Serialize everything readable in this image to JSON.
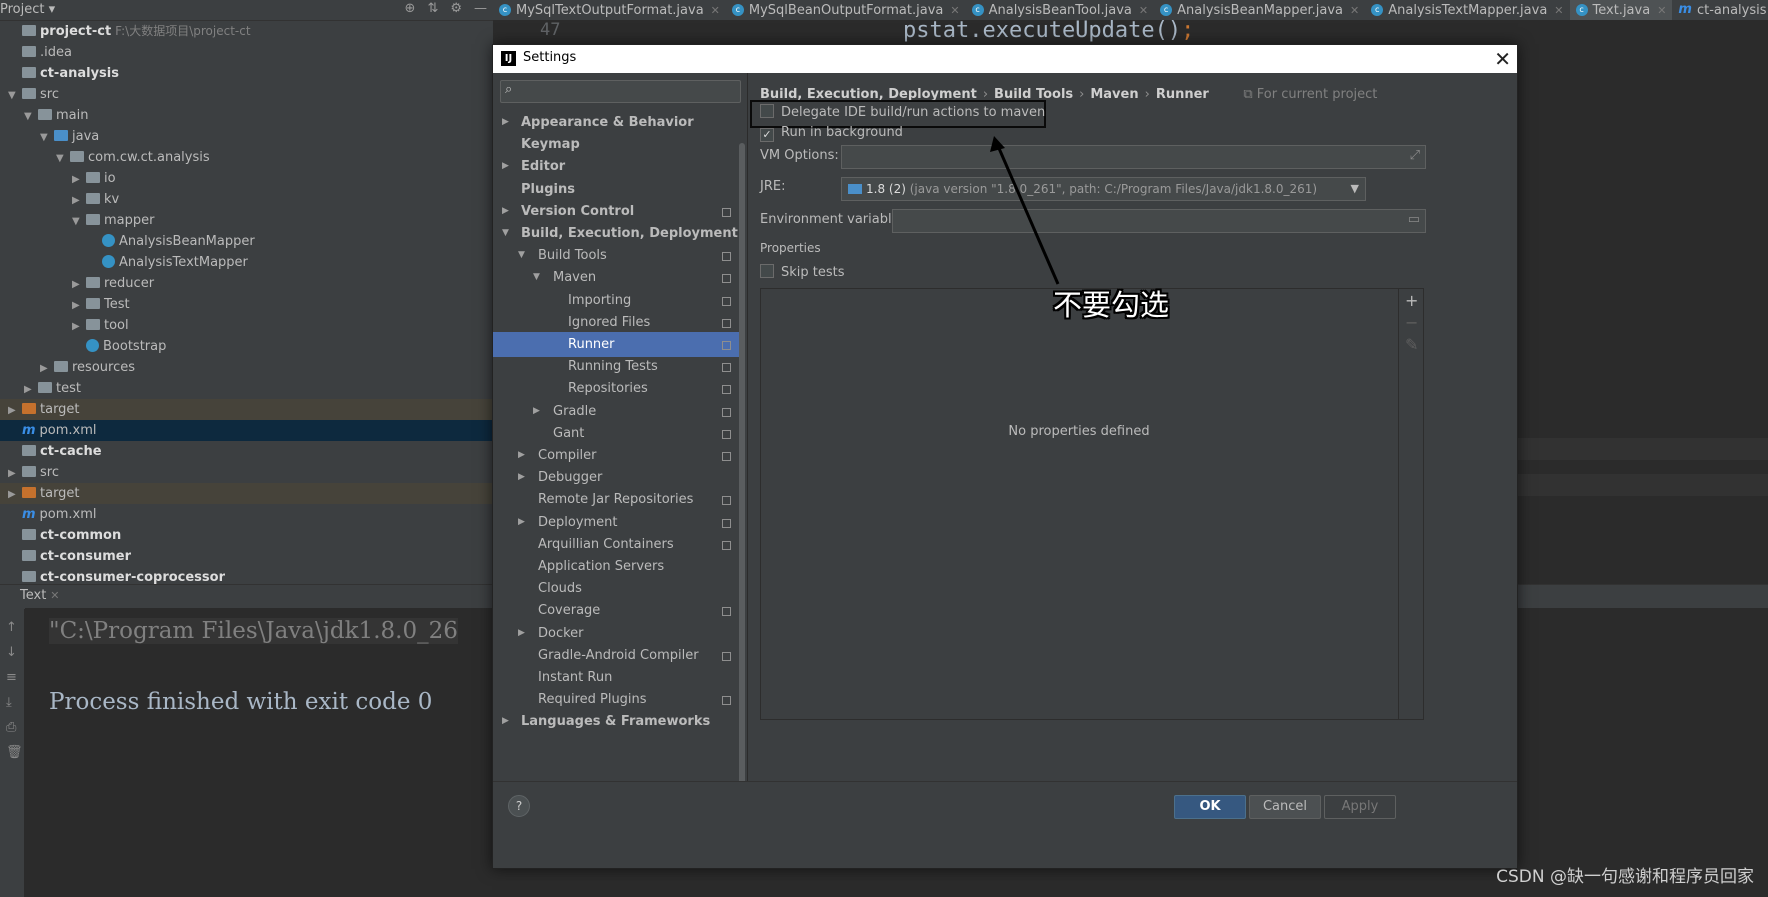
{
  "project_header": {
    "title": "Project ▾"
  },
  "editor_tabs": [
    {
      "label": "MySqlTextOutputFormat.java",
      "icon": "class-icon"
    },
    {
      "label": "MySqlBeanOutputFormat.java",
      "icon": "class-icon"
    },
    {
      "label": "AnalysisBeanTool.java",
      "icon": "class-icon"
    },
    {
      "label": "AnalysisBeanMapper.java",
      "icon": "class-icon"
    },
    {
      "label": "AnalysisTextMapper.java",
      "icon": "class-icon"
    },
    {
      "label": "Text.java",
      "icon": "class-icon",
      "active": true
    },
    {
      "label": "ct-analysis",
      "icon": "maven-icon"
    }
  ],
  "code": {
    "line_no": "47",
    "line": "pstat.executeUpdate()",
    "semi": ";"
  },
  "project_tree": [
    {
      "label": "project-ct",
      "extra": "F:\\大数据项目\\project-ct",
      "bold": true,
      "indent": 0,
      "arrow": "",
      "icon": "folder"
    },
    {
      "label": ".idea",
      "indent": 0,
      "arrow": "",
      "icon": "folder"
    },
    {
      "label": "ct-analysis",
      "bold": true,
      "indent": 0,
      "arrow": "",
      "icon": "folder"
    },
    {
      "label": "src",
      "indent": 0,
      "arrow": "▼",
      "icon": "folder"
    },
    {
      "label": "main",
      "indent": 1,
      "arrow": "▼",
      "icon": "folder"
    },
    {
      "label": "java",
      "indent": 2,
      "arrow": "▼",
      "icon": "folder-blue"
    },
    {
      "label": "com.cw.ct.analysis",
      "indent": 3,
      "arrow": "▼",
      "icon": "folder"
    },
    {
      "label": "io",
      "indent": 4,
      "arrow": "▶",
      "icon": "folder"
    },
    {
      "label": "kv",
      "indent": 4,
      "arrow": "▶",
      "icon": "folder"
    },
    {
      "label": "mapper",
      "indent": 4,
      "arrow": "▼",
      "icon": "folder"
    },
    {
      "label": "AnalysisBeanMapper",
      "indent": 5,
      "arrow": "",
      "icon": "class"
    },
    {
      "label": "AnalysisTextMapper",
      "indent": 5,
      "arrow": "",
      "icon": "class"
    },
    {
      "label": "reducer",
      "indent": 4,
      "arrow": "▶",
      "icon": "folder"
    },
    {
      "label": "Test",
      "indent": 4,
      "arrow": "▶",
      "icon": "folder"
    },
    {
      "label": "tool",
      "indent": 4,
      "arrow": "▶",
      "icon": "folder"
    },
    {
      "label": "Bootstrap",
      "indent": 4,
      "arrow": "",
      "icon": "class"
    },
    {
      "label": "resources",
      "indent": 2,
      "arrow": "▶",
      "icon": "folder"
    },
    {
      "label": "test",
      "indent": 1,
      "arrow": "▶",
      "icon": "folder"
    },
    {
      "label": "target",
      "indent": 0,
      "arrow": "▶",
      "icon": "folder-orange",
      "hl": "target"
    },
    {
      "label": "pom.xml",
      "indent": 0,
      "arrow": "",
      "icon": "maven",
      "hl": "pom"
    },
    {
      "label": "ct-cache",
      "bold": true,
      "indent": 0,
      "arrow": "",
      "icon": "folder"
    },
    {
      "label": "src",
      "indent": 0,
      "arrow": "▶",
      "icon": "folder"
    },
    {
      "label": "target",
      "indent": 0,
      "arrow": "▶",
      "icon": "folder-orange",
      "hl": "target"
    },
    {
      "label": "pom.xml",
      "indent": 0,
      "arrow": "",
      "icon": "maven"
    },
    {
      "label": "ct-common",
      "bold": true,
      "indent": 0,
      "arrow": "",
      "icon": "folder"
    },
    {
      "label": "ct-consumer",
      "bold": true,
      "indent": 0,
      "arrow": "",
      "icon": "folder"
    },
    {
      "label": "ct-consumer-coprocessor",
      "bold": true,
      "indent": 0,
      "arrow": "",
      "icon": "folder"
    }
  ],
  "run_panel": {
    "tab": "Text",
    "line1": "\"C:\\Program Files\\Java\\jdk1.8.0_26",
    "line2": "Process finished with exit code 0"
  },
  "dialog": {
    "title": "Settings",
    "search_placeholder": "",
    "nav": [
      {
        "label": "Appearance & Behavior",
        "bold": true,
        "arrow": "▶",
        "level": 0
      },
      {
        "label": "Keymap",
        "bold": true,
        "arrow": "",
        "level": 0
      },
      {
        "label": "Editor",
        "bold": true,
        "arrow": "▶",
        "level": 0
      },
      {
        "label": "Plugins",
        "bold": true,
        "arrow": "",
        "level": 0
      },
      {
        "label": "Version Control",
        "bold": true,
        "arrow": "▶",
        "level": 0,
        "proj": true
      },
      {
        "label": "Build, Execution, Deployment",
        "bold": true,
        "arrow": "▼",
        "level": 0
      },
      {
        "label": "Build Tools",
        "arrow": "▼",
        "level": 1,
        "proj": true
      },
      {
        "label": "Maven",
        "arrow": "▼",
        "level": 2,
        "proj": true
      },
      {
        "label": "Importing",
        "arrow": "",
        "level": 3,
        "proj": true
      },
      {
        "label": "Ignored Files",
        "arrow": "",
        "level": 3,
        "proj": true
      },
      {
        "label": "Runner",
        "arrow": "",
        "level": 3,
        "proj": true,
        "selected": true
      },
      {
        "label": "Running Tests",
        "arrow": "",
        "level": 3,
        "proj": true
      },
      {
        "label": "Repositories",
        "arrow": "",
        "level": 3,
        "proj": true
      },
      {
        "label": "Gradle",
        "arrow": "▶",
        "level": 2,
        "proj": true
      },
      {
        "label": "Gant",
        "arrow": "",
        "level": 2,
        "proj": true
      },
      {
        "label": "Compiler",
        "arrow": "▶",
        "level": 1,
        "proj": true
      },
      {
        "label": "Debugger",
        "arrow": "▶",
        "level": 1
      },
      {
        "label": "Remote Jar Repositories",
        "arrow": "",
        "level": 1,
        "proj": true
      },
      {
        "label": "Deployment",
        "arrow": "▶",
        "level": 1,
        "proj": true
      },
      {
        "label": "Arquillian Containers",
        "arrow": "",
        "level": 1,
        "proj": true
      },
      {
        "label": "Application Servers",
        "arrow": "",
        "level": 1
      },
      {
        "label": "Clouds",
        "arrow": "",
        "level": 1
      },
      {
        "label": "Coverage",
        "arrow": "",
        "level": 1,
        "proj": true
      },
      {
        "label": "Docker",
        "arrow": "▶",
        "level": 1
      },
      {
        "label": "Gradle-Android Compiler",
        "arrow": "",
        "level": 1,
        "proj": true
      },
      {
        "label": "Instant Run",
        "arrow": "",
        "level": 1
      },
      {
        "label": "Required Plugins",
        "arrow": "",
        "level": 1,
        "proj": true
      },
      {
        "label": "Languages & Frameworks",
        "bold": true,
        "arrow": "▶",
        "level": 0
      }
    ],
    "breadcrumb": [
      "Build, Execution, Deployment",
      "Build Tools",
      "Maven",
      "Runner"
    ],
    "breadcrumb_note": "For current project",
    "delegate_label": "Delegate IDE build/run actions to maven",
    "delegate_checked": false,
    "background_label": "Run in background",
    "background_checked": true,
    "vm_label": "VM Options:",
    "vm_value": "",
    "jre_label": "JRE:",
    "jre_version": "1.8 (2)",
    "jre_detail": "(java version \"1.8.0_261\", path: C:/Program Files/Java/jdk1.8.0_261)",
    "env_label": "Environment variables:",
    "env_value": "",
    "properties_label": "Properties",
    "skip_tests_label": "Skip tests",
    "skip_tests_checked": false,
    "no_properties": "No properties defined",
    "buttons": {
      "ok": "OK",
      "cancel": "Cancel",
      "apply": "Apply",
      "help": "?"
    }
  },
  "annotation": {
    "text": "不要勾选",
    "color": "#ffffff"
  },
  "watermark": "CSDN @缺一句感谢和程序员回家"
}
